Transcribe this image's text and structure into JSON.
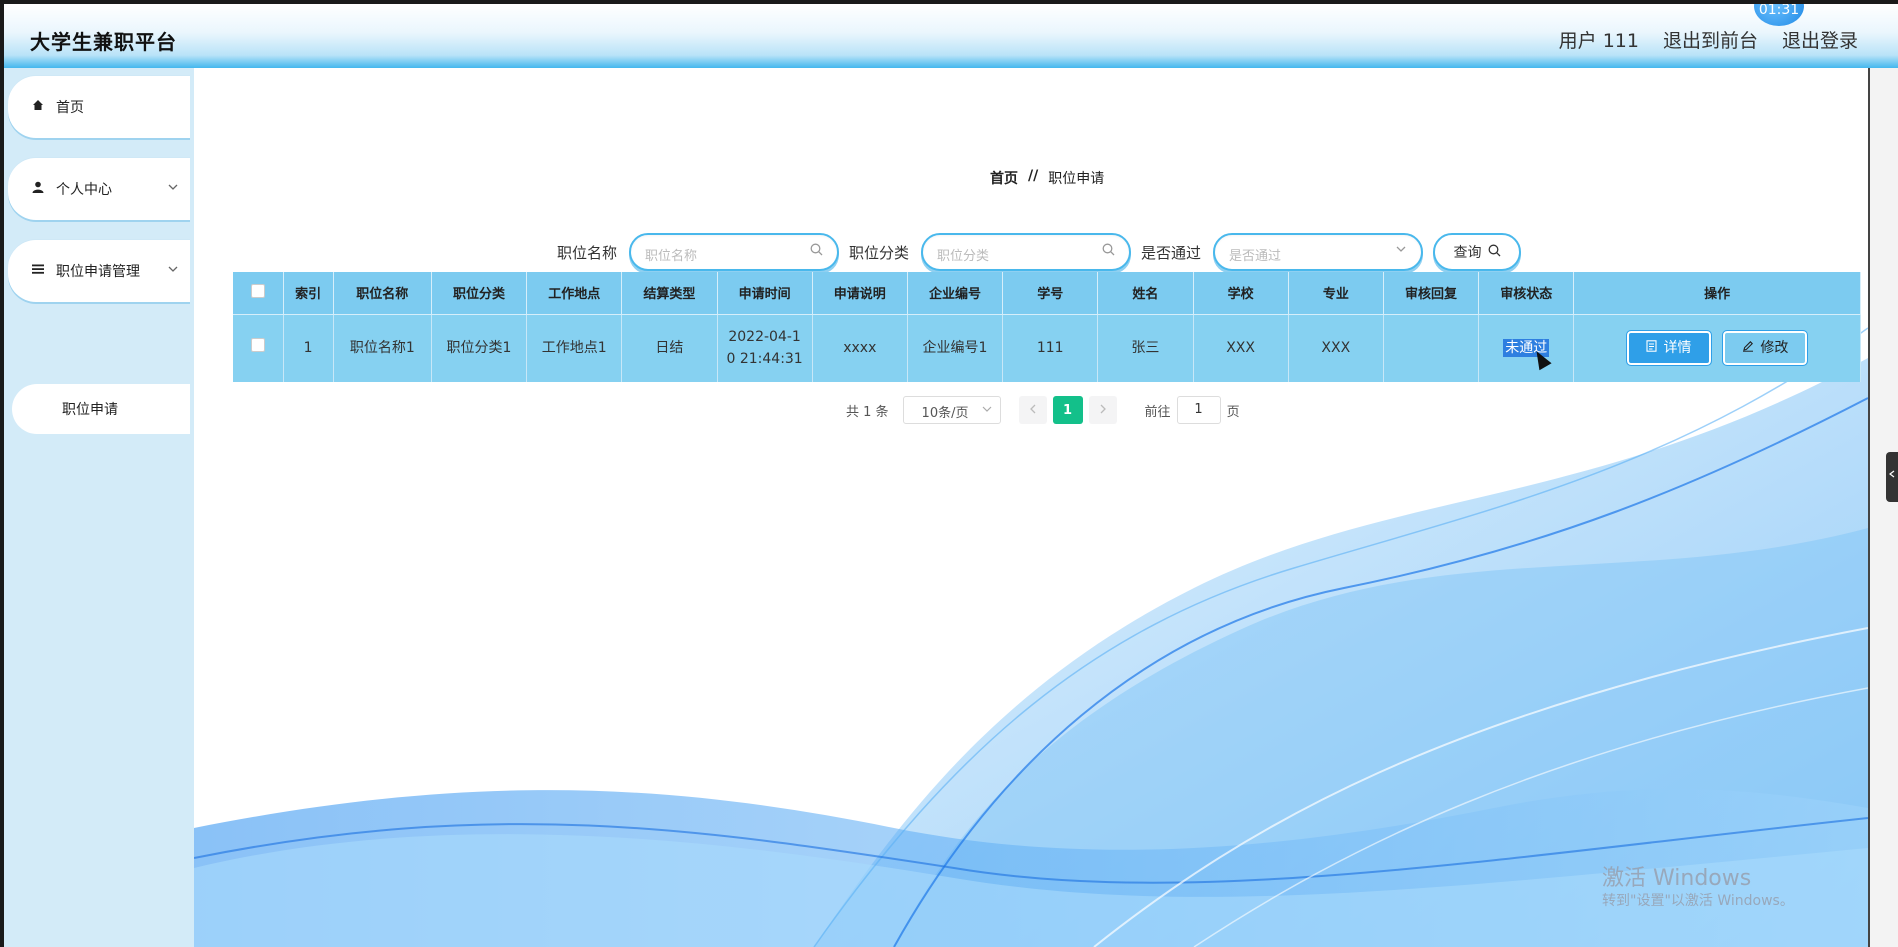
{
  "app": {
    "title": "大学生兼职平台",
    "clock": "01:31"
  },
  "topnav": {
    "user": "用户 111",
    "front": "退出到前台",
    "logout": "退出登录"
  },
  "sidebar": {
    "items": [
      {
        "label": "首页",
        "icon": "home-icon"
      },
      {
        "label": "个人中心",
        "icon": "user-icon"
      },
      {
        "label": "职位申请管理",
        "icon": "list-icon"
      }
    ],
    "sub_label": "职位申请"
  },
  "breadcrumb": {
    "home": "首页",
    "sep": "//",
    "current": "职位申请"
  },
  "search": {
    "name_label": "职位名称",
    "name_placeholder": "职位名称",
    "cat_label": "职位分类",
    "cat_placeholder": "职位分类",
    "pass_label": "是否通过",
    "pass_placeholder": "是否通过",
    "query_label": "查询"
  },
  "table": {
    "headers": [
      "索引",
      "职位名称",
      "职位分类",
      "工作地点",
      "结算类型",
      "申请时间",
      "申请说明",
      "企业编号",
      "学号",
      "姓名",
      "学校",
      "专业",
      "审核回复",
      "审核状态",
      "操作"
    ],
    "row": {
      "index": "1",
      "name": "职位名称1",
      "category": "职位分类1",
      "location": "工作地点1",
      "settle": "日结",
      "time_a": "2022-04-1",
      "time_b": "0 21:44:31",
      "desc": "xxxx",
      "company": "企业编号1",
      "student_id": "111",
      "student_name": "张三",
      "school": "XXX",
      "major": "XXX",
      "reply": "",
      "status": "未通过",
      "detail_btn": "详情",
      "edit_btn": "修改"
    }
  },
  "pager": {
    "total": "共 1 条",
    "size": "10条/页",
    "page": "1",
    "goto": "前往",
    "goto_val": "1",
    "page_unit": "页"
  },
  "watermark": {
    "line1": "激活 Windows",
    "line2": "转到\"设置\"以激活 Windows。"
  },
  "colors": {
    "accent": "#49b8ec",
    "header": "#7ccbf0",
    "row": "#86d1f1",
    "page_active": "#13c08a"
  }
}
